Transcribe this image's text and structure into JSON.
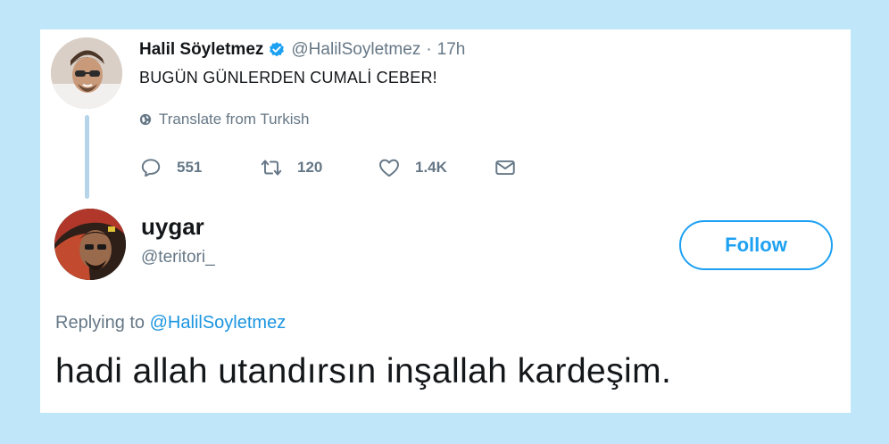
{
  "original_tweet": {
    "name": "Halil Söyletmez",
    "handle": "@HalilSoyletmez",
    "separator": "·",
    "time": "17h",
    "text": "BUGÜN GÜNLERDEN CUMALİ CEBER!",
    "translate_label": "Translate from Turkish",
    "actions": {
      "replies": "551",
      "retweets": "120",
      "likes": "1.4K"
    }
  },
  "reply_tweet": {
    "name": "uygar",
    "handle": "@teritori_",
    "follow_label": "Follow",
    "replying_prefix": "Replying to",
    "replying_handle": "@HalilSoyletmez",
    "text": "hadi allah utandırsın inşallah kardeşim."
  },
  "colors": {
    "background": "#bfe6f9",
    "accent": "#1da1f2",
    "muted": "#657786",
    "text": "#14171a"
  },
  "icons": [
    "verified-badge-icon",
    "globe-icon",
    "reply-icon",
    "retweet-icon",
    "like-icon",
    "direct-message-icon"
  ]
}
